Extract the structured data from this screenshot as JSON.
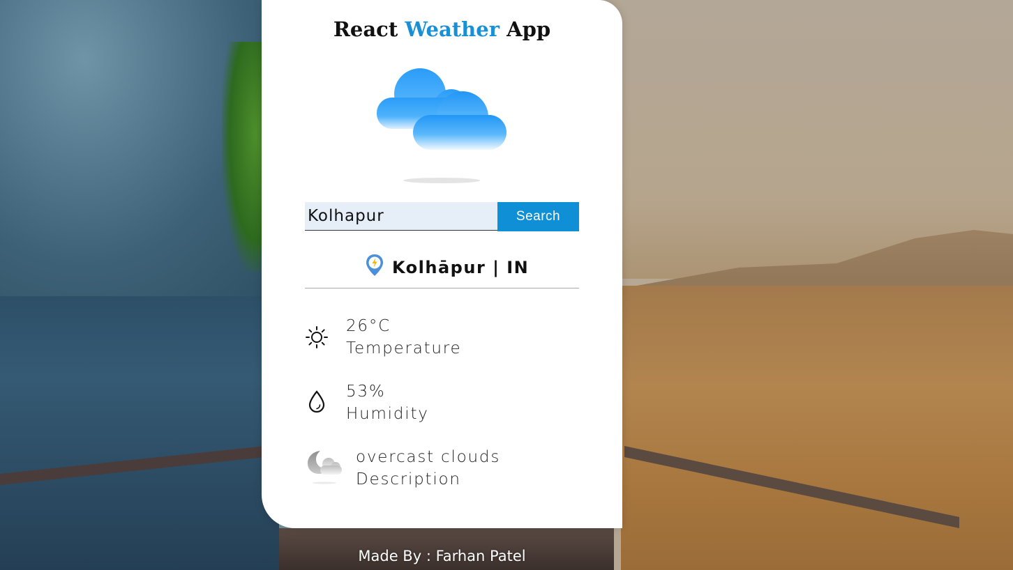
{
  "app": {
    "title_part1": "React",
    "title_part2": "Weather",
    "title_part3": "App",
    "accent_color": "#1a8fd4"
  },
  "search": {
    "value": "Kolhapur",
    "button_label": "Search",
    "button_color": "#0f8fd6"
  },
  "location": {
    "icon": "location-pin-icon",
    "text": "Kolhāpur | IN"
  },
  "stats": {
    "temperature": {
      "icon": "sun-icon",
      "value": "26°C",
      "label": "Temperature"
    },
    "humidity": {
      "icon": "water-drop-icon",
      "value": "53%",
      "label": "Humidity"
    },
    "description": {
      "icon": "night-cloud-icon",
      "value": "overcast clouds",
      "label": "Description"
    }
  },
  "hero_icon": "clouds-icon",
  "footer": {
    "text": "Made By : Farhan Patel"
  }
}
